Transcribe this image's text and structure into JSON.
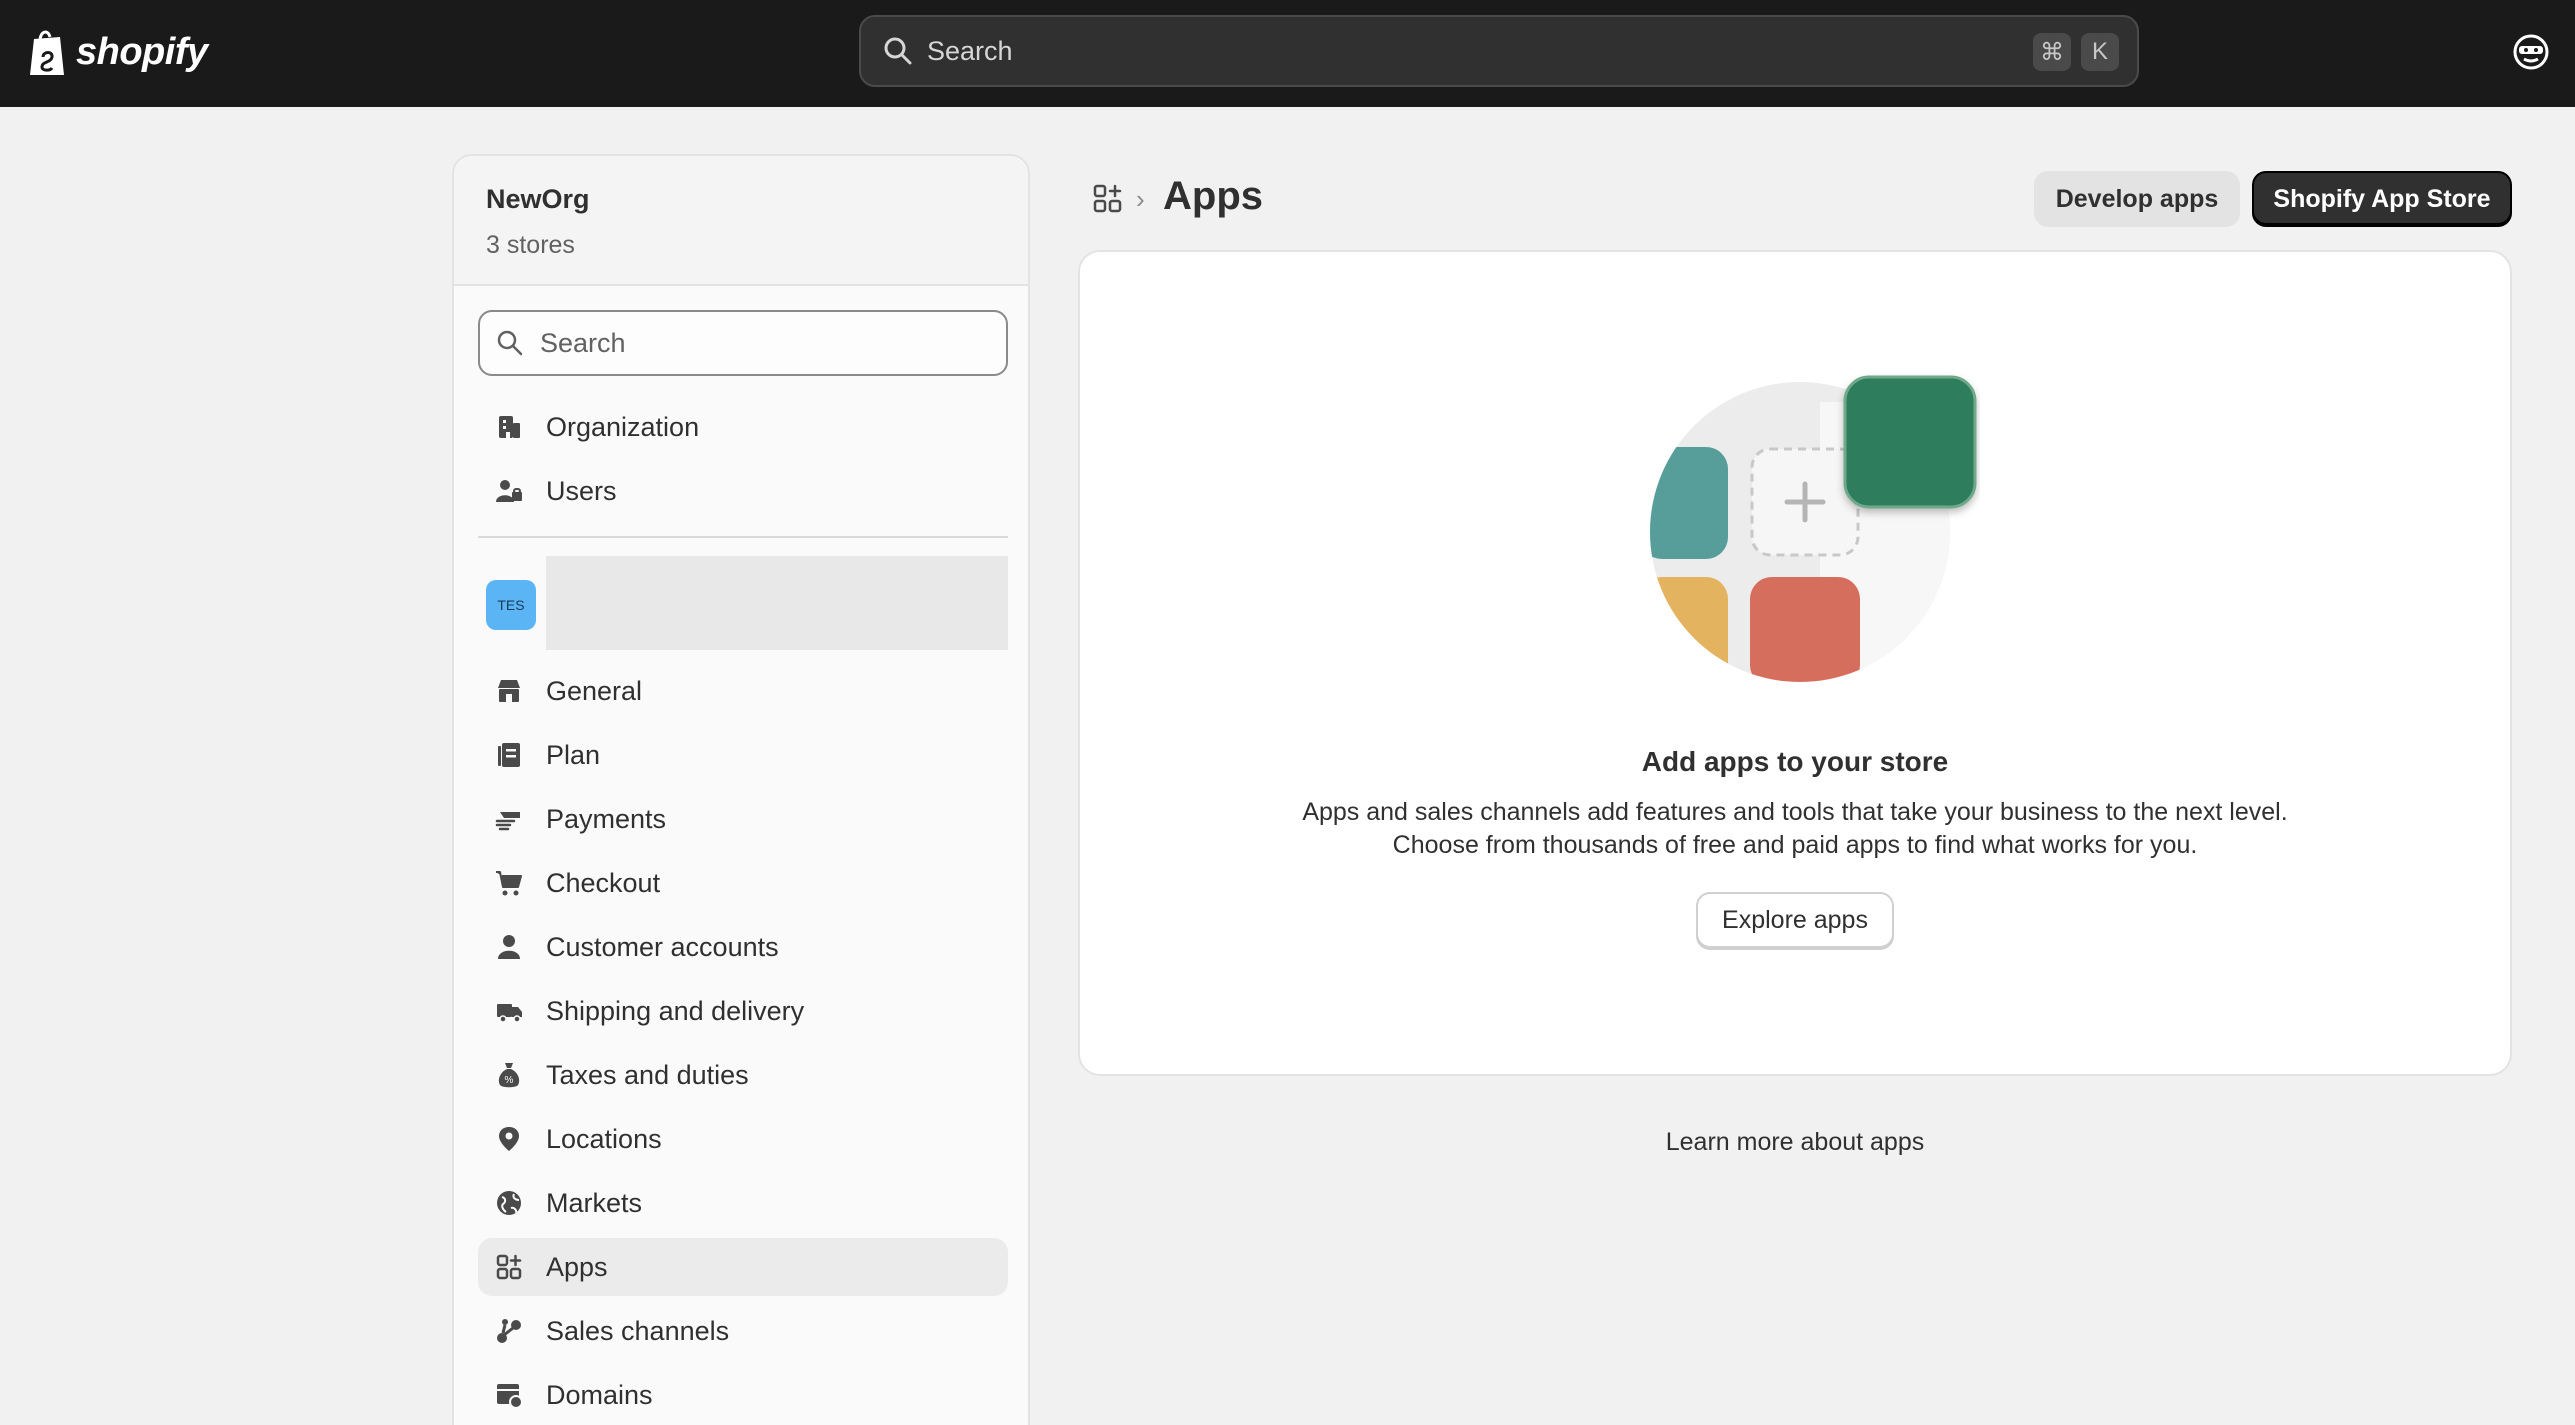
{
  "topbar": {
    "brand": "shopify",
    "search_placeholder": "Search",
    "shortcut_keys": [
      "⌘",
      "K"
    ]
  },
  "sidebar": {
    "org_name": "NewOrg",
    "org_sub": "3 stores",
    "search_placeholder": "Search",
    "top_items": [
      {
        "label": "Organization",
        "icon": "building-icon"
      },
      {
        "label": "Users",
        "icon": "users-icon"
      }
    ],
    "store_badge": "TES",
    "items": [
      {
        "label": "General",
        "icon": "store-icon"
      },
      {
        "label": "Plan",
        "icon": "plan-icon"
      },
      {
        "label": "Payments",
        "icon": "payments-icon"
      },
      {
        "label": "Checkout",
        "icon": "cart-icon"
      },
      {
        "label": "Customer accounts",
        "icon": "person-icon"
      },
      {
        "label": "Shipping and delivery",
        "icon": "truck-icon"
      },
      {
        "label": "Taxes and duties",
        "icon": "tax-icon"
      },
      {
        "label": "Locations",
        "icon": "location-icon"
      },
      {
        "label": "Markets",
        "icon": "globe-icon"
      },
      {
        "label": "Apps",
        "icon": "apps-icon",
        "active": true
      },
      {
        "label": "Sales channels",
        "icon": "sales-channels-icon"
      },
      {
        "label": "Domains",
        "icon": "domains-icon"
      }
    ]
  },
  "header": {
    "title": "Apps",
    "develop_label": "Develop apps",
    "store_label": "Shopify App Store"
  },
  "empty_state": {
    "title": "Add apps to your store",
    "desc_line1": "Apps and sales channels add features and tools that take your business to the next level.",
    "desc_line2": "Choose from thousands of free and paid apps to find what works for you.",
    "button_label": "Explore apps"
  },
  "footer": {
    "learn_more": "Learn more about apps"
  },
  "colors": {
    "topbar": "#1a1a1a",
    "tile_teal": "#579e9a",
    "tile_green": "#2e7d5b",
    "tile_yellow": "#e3b35f",
    "tile_red": "#d66e5e",
    "badge": "#5bb5f5"
  }
}
